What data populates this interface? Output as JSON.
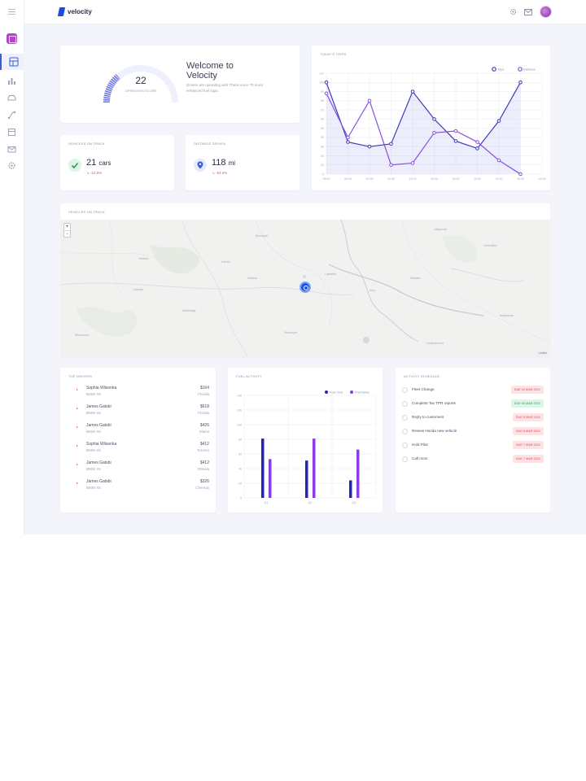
{
  "brand": {
    "name": "velocity"
  },
  "nav": {
    "items": [
      "dashboard",
      "analytics",
      "vehicles",
      "routes",
      "reports",
      "messages",
      "settings"
    ],
    "active": "dashboard"
  },
  "welcome": {
    "score": "22",
    "score_label": "Operating Score",
    "title": "Welcome to Velocity",
    "text": "Drivers are operating with Theta score 70 more enhanced fuel logic."
  },
  "stats": [
    {
      "title": "Vehicles on Track",
      "value": "21",
      "unit": "cars",
      "delta": "↘ -12.5%",
      "icon": "check-icon",
      "color": "#2e9b58"
    },
    {
      "title": "Distance Driven",
      "value": "118",
      "unit": "mi",
      "delta": "↘ -64.5%",
      "icon": "map-pin-icon",
      "color": "#3b5bdb"
    }
  ],
  "trip_chart": {
    "title": "Today's Trips",
    "chart_data": {
      "type": "line",
      "x": [
        "06:00",
        "08:00",
        "10:00",
        "12:00",
        "14:00",
        "16:00",
        "18:00",
        "20:00",
        "22:00",
        "00:00",
        "02:00"
      ],
      "series": [
        {
          "name": "Trips",
          "color": "#3d3ab8",
          "values": [
            100,
            35,
            30,
            33,
            90,
            60,
            36,
            28,
            58,
            100
          ]
        },
        {
          "name": "Distance",
          "color": "#8a4fe0",
          "values": [
            88,
            40,
            80,
            10,
            12,
            45,
            47,
            35,
            15,
            0
          ]
        }
      ],
      "ylim": [
        0,
        110
      ],
      "yticks": [
        "0",
        "10",
        "20",
        "30",
        "40",
        "50",
        "60",
        "70",
        "80",
        "90",
        "100",
        "110"
      ],
      "grid": true,
      "legend": "top-right"
    }
  },
  "map": {
    "title": "Vehicles on Track",
    "zoom_in": "+",
    "zoom_out": "-",
    "attribution": "Leaflet",
    "labels": [
      "Hobbart",
      "Carrick",
      "Bunstown",
      "Midland",
      "Lakeside",
      "Moy",
      "Cabrian",
      "Kilcullen",
      "Greenfield",
      "Ashbourne",
      "Ellenmount",
      "Dunboyne",
      "Maynooth",
      "Newbridge",
      "Castledermot"
    ]
  },
  "drivers": {
    "title": "Top Drivers",
    "rows": [
      {
        "name": "Sophia Wilsonka",
        "car": "BMW X5",
        "amount": "$164",
        "city": "Florida"
      },
      {
        "name": "James Gatsbi",
        "car": "BMW X5",
        "amount": "$618",
        "city": "Florida"
      },
      {
        "name": "James Gatsbi",
        "car": "BMW X5",
        "amount": "$426",
        "city": "Miami"
      },
      {
        "name": "Sophia Wilsonka",
        "car": "BMW X5",
        "amount": "$412",
        "city": "Toronto"
      },
      {
        "name": "James Gatsbi",
        "car": "BMW X5",
        "amount": "$412",
        "city": "Ottawa"
      },
      {
        "name": "James Gatsbi",
        "car": "BMW X5",
        "amount": "$326",
        "city": "Chennai"
      }
    ]
  },
  "fuel": {
    "title": "Fuel Activity",
    "chart_data": {
      "type": "bar",
      "categories": [
        "Q1",
        "Q2",
        "Q3"
      ],
      "series": [
        {
          "name": "Fuel Cost",
          "color": "#2325b8",
          "values": [
            81,
            51,
            24
          ]
        },
        {
          "name": "Purchases",
          "color": "#8a3de6",
          "values": [
            53,
            81,
            66
          ]
        }
      ],
      "ylim": [
        0,
        140
      ],
      "yticks": [
        "0",
        "20",
        "40",
        "60",
        "80",
        "100",
        "120",
        "140"
      ],
      "grid": true,
      "legend": "top-right"
    }
  },
  "schedule": {
    "title": "Activity Schedule",
    "rows": [
      {
        "label": "Fleet Change",
        "badge": "DUE 02 MAR 2021",
        "status": "red"
      },
      {
        "label": "Complete Tax TPR reports",
        "badge": "DUE 04 MAR 2021",
        "status": "green"
      },
      {
        "label": "Reply to customers",
        "badge": "DUE 5 MAR 2021",
        "status": "red"
      },
      {
        "label": "Review Honda new vehicle",
        "badge": "DUE 6 MAR 2021",
        "status": "red"
      },
      {
        "label": "Hold Pilot",
        "badge": "DUE 7 MAR 2021",
        "status": "red"
      },
      {
        "label": "Call mom",
        "badge": "DUE 7 MAR 2021",
        "status": "red"
      }
    ]
  }
}
